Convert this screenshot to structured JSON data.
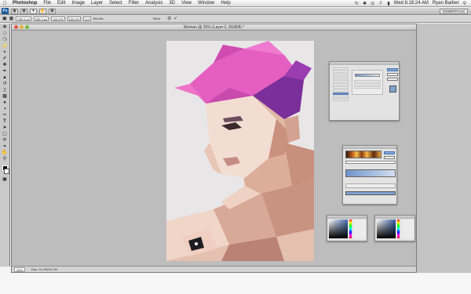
{
  "menubar": {
    "apple": "",
    "items": [
      "Photoshop",
      "File",
      "Edit",
      "Image",
      "Layer",
      "Select",
      "Filter",
      "Analysis",
      "3D",
      "View",
      "Window",
      "Help"
    ],
    "clock": "Wed 8:18:24 AM",
    "user": "Ryan Barber"
  },
  "appbar": {
    "logo": "Ps",
    "workspace": "ESSENTIALS"
  },
  "optbar": {
    "x_value": "250.0 px",
    "y_value": "250.0 px",
    "w_value": "100.0%",
    "h_value": "100.0%",
    "angle_value": "0.0",
    "interpolation": "Bicubic",
    "blend_label": "Warp"
  },
  "document": {
    "title": "Woman @ 25% (Layer 2, RGB/8) *",
    "zoom": "25%",
    "doc_info": "Doc: 24.7M/24.7M"
  },
  "colors": {
    "hair_light": "#e45fc0",
    "hair_dark": "#7a2f9a",
    "skin_light": "#f3ddd2",
    "skin_mid": "#d9a997",
    "skin_shadow": "#a6766a",
    "canvas_bg": "#e9e6e8"
  }
}
